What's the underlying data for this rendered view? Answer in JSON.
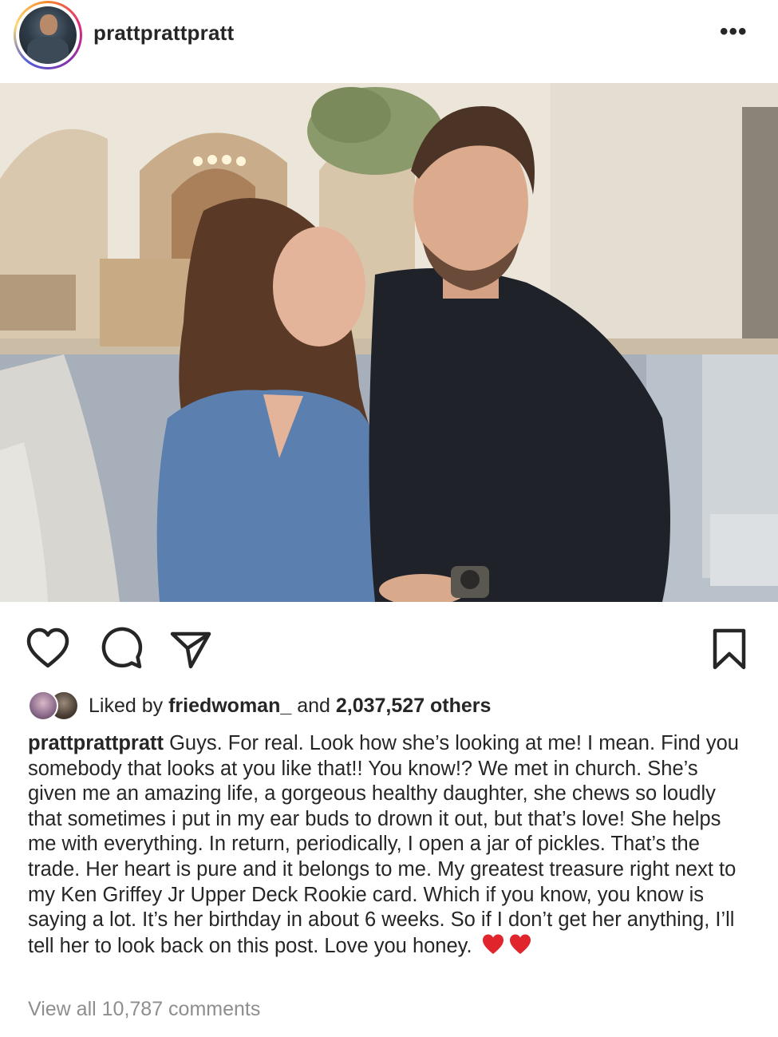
{
  "post": {
    "username": "prattprattpratt",
    "more_icon": "more-horizontal-icon",
    "more_glyph": "•••"
  },
  "actions": {
    "like_icon": "heart-icon",
    "comment_icon": "comment-icon",
    "share_icon": "send-icon",
    "save_icon": "bookmark-icon"
  },
  "likes": {
    "prefix": "Liked by ",
    "liker": "friedwoman_",
    "middle": " and ",
    "count": "2,037,527 others"
  },
  "caption": {
    "username": "prattprattpratt",
    "text": " Guys. For real. Look how she’s looking at me! I mean. Find you somebody that looks at you like that!! You know!? We met in church. She’s given me an amazing life, a gorgeous healthy daughter, she chews so loudly that sometimes i put in my ear buds to drown it out, but that’s love! She helps me with everything. In return, periodically, I open a jar of pickles. That’s the trade. Her heart is pure and it belongs to me. My greatest treasure right next to my Ken Griffey Jr Upper Deck Rookie card. Which if you know, you know is saying a lot. It’s her birthday in about 6 weeks. So if I don’t get her anything, I’ll tell her to look back on this post. Love you honey. ",
    "emoji": [
      "red-heart-emoji",
      "red-heart-emoji"
    ]
  },
  "comments": {
    "view_all": "View all 10,787 comments"
  },
  "colors": {
    "text": "#262626",
    "muted": "#8e8e8e",
    "heart_red": "#e0262c"
  }
}
